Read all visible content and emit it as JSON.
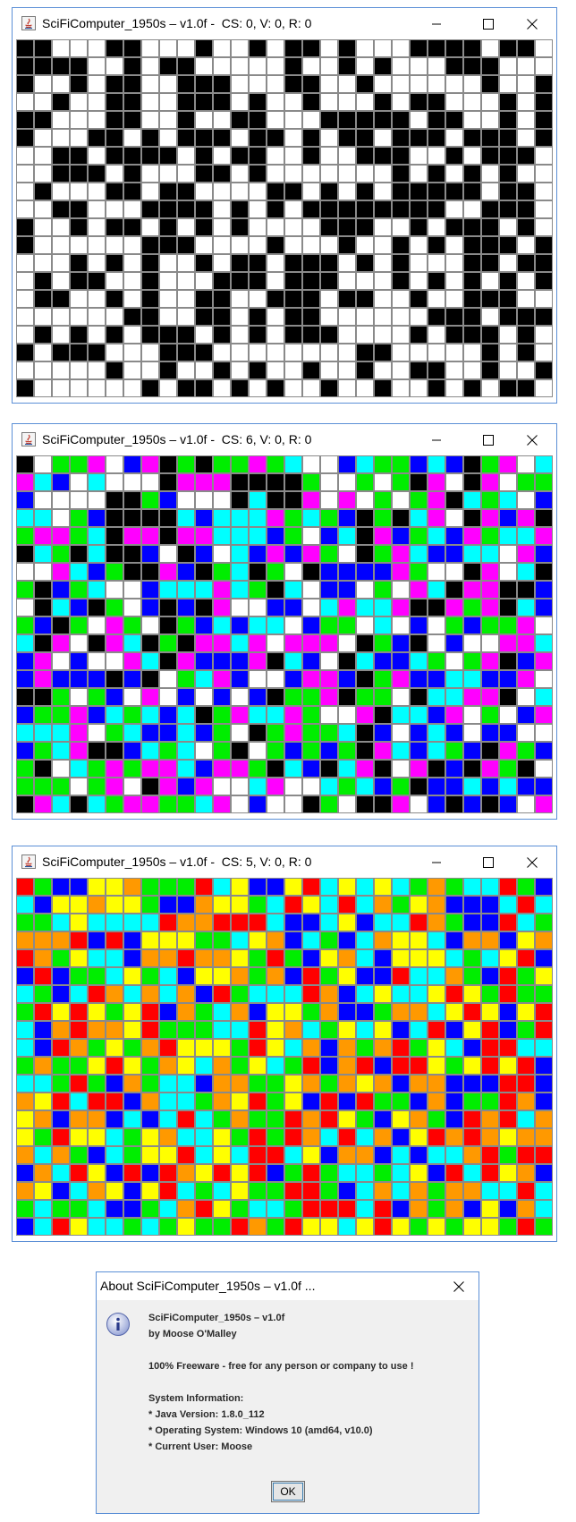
{
  "windows": [
    {
      "title": "SciFiComputer_1950s – v1.0f -  CS: 0, V: 0, R: 0",
      "palette": [
        "#000000",
        "#ffffff"
      ],
      "grid": {
        "cols": 30,
        "rows": 20
      }
    },
    {
      "title": "SciFiComputer_1950s – v1.0f -  CS: 6, V: 0, R: 0",
      "palette": [
        "#000000",
        "#ffffff",
        "#00ffff",
        "#ff00ff",
        "#00ee00",
        "#0000ff"
      ],
      "grid": {
        "cols": 30,
        "rows": 20
      }
    },
    {
      "title": "SciFiComputer_1950s – v1.0f -  CS: 5, V: 0, R: 0",
      "palette": [
        "#ff0000",
        "#ff9900",
        "#ffff00",
        "#00ee00",
        "#00ffff",
        "#0000ff"
      ],
      "grid": {
        "cols": 30,
        "rows": 20
      }
    }
  ],
  "window_controls": {
    "minimize_icon": "minimize-icon",
    "maximize_icon": "maximize-icon",
    "close_icon": "close-icon"
  },
  "about_dialog": {
    "title": "About SciFiComputer_1950s – v1.0f ...",
    "icon": "info-icon",
    "lines": [
      "SciFiComputer_1950s – v1.0f",
      "by Moose O'Malley",
      "",
      "100% Freeware - free for any person or company to use !",
      "",
      "System Information:",
      "* Java Version: 1.8.0_112",
      "* Operating System: Windows 10 (amd64, v10.0)",
      "* Current User: Moose"
    ],
    "ok_label": "OK"
  }
}
